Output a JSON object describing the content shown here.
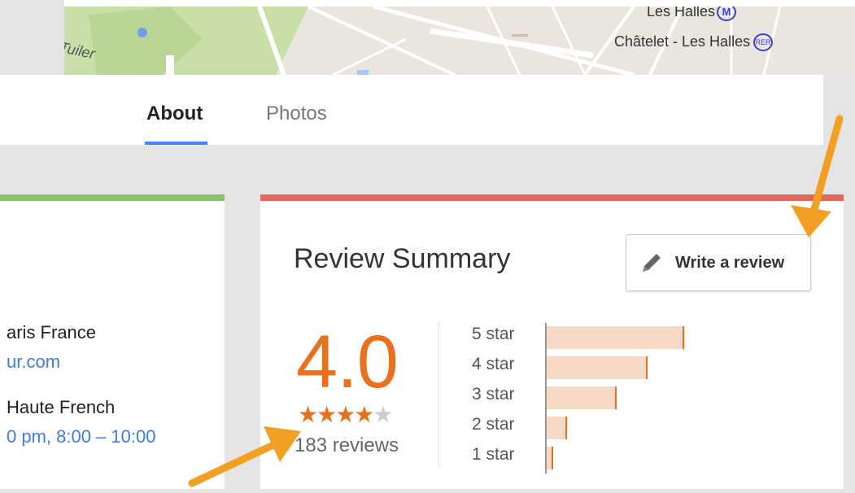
{
  "map": {
    "label_tuileries": "Tuiler",
    "label_les_halles": "Les Halles",
    "label_metro_symbol": "M",
    "label_chatelet": "Châtelet - Les Halles",
    "label_rer_symbol": "RER",
    "colors": {
      "park": "#c8dfa8",
      "road": "#ffffff",
      "water": "#a8c8f0"
    }
  },
  "tabs": [
    {
      "label": "About",
      "active": true
    },
    {
      "label": "Photos",
      "active": false
    }
  ],
  "info_card": {
    "address_fragment": "aris France",
    "website_fragment": "ur.com",
    "category_fragment": "Haute French",
    "hours_fragment": "0 pm, 8:00 – 10:00",
    "accent_color": "#8bc36a"
  },
  "review_summary": {
    "title": "Review Summary",
    "write_review_label": "Write a review",
    "pencil_icon": "pencil-icon",
    "rating": "4.0",
    "stars_full": "★★★★",
    "stars_empty": "★",
    "review_count": "183 reviews",
    "accent_color": "#e2685c",
    "rating_color": "#e8711e",
    "distribution": [
      {
        "label": "5 star",
        "share": 0.88
      },
      {
        "label": "4 star",
        "share": 0.64
      },
      {
        "label": "3 star",
        "share": 0.44
      },
      {
        "label": "2 star",
        "share": 0.12
      },
      {
        "label": "1 star",
        "share": 0.03
      }
    ]
  },
  "annotations": {
    "arrow_color": "#f2a024"
  }
}
